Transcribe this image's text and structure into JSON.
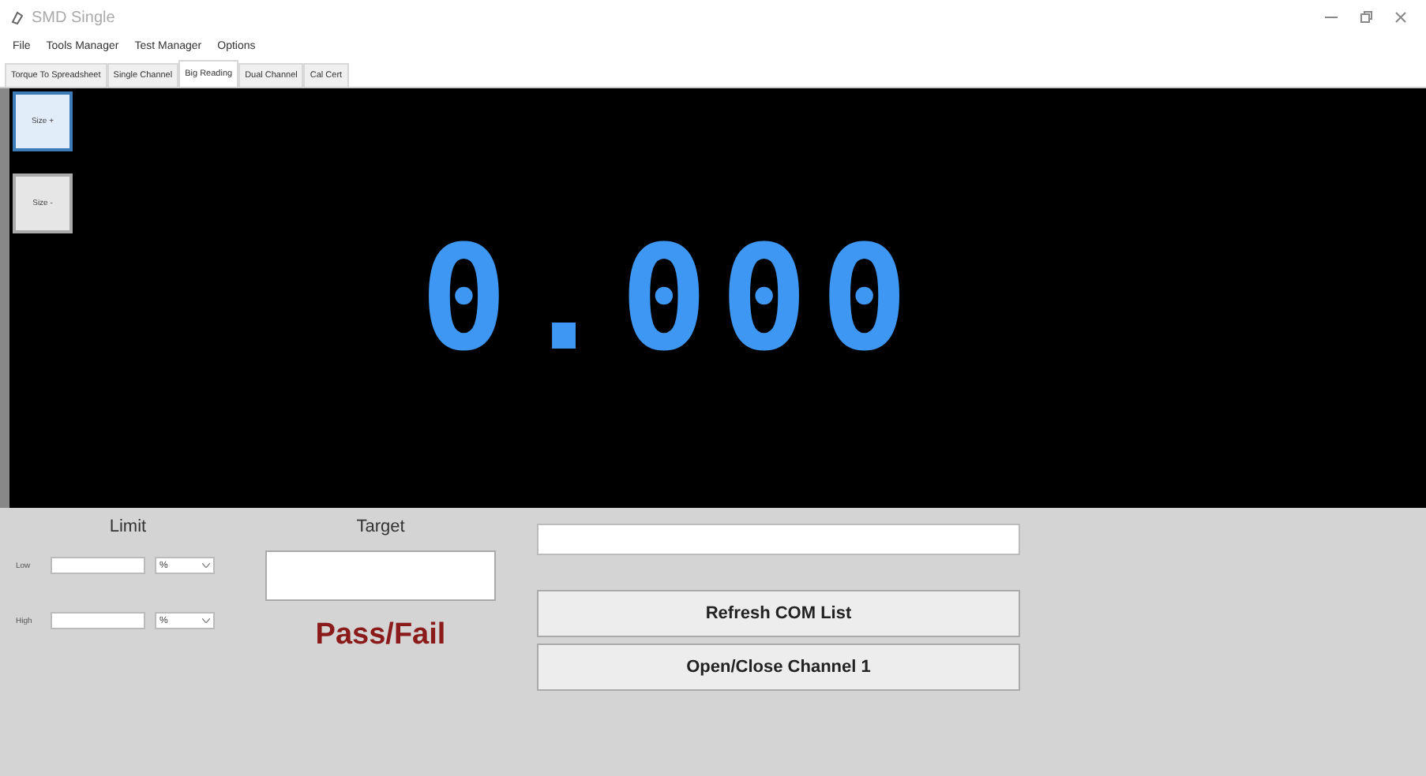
{
  "window": {
    "title": "SMD Single"
  },
  "menu": [
    "File",
    "Tools Manager",
    "Test Manager",
    "Options"
  ],
  "tabs": [
    {
      "label": "Torque To Spreadsheet",
      "selected": false
    },
    {
      "label": "Single Channel",
      "selected": false
    },
    {
      "label": "Big Reading",
      "selected": true
    },
    {
      "label": "Dual Channel",
      "selected": false
    },
    {
      "label": "Cal Cert",
      "selected": false
    }
  ],
  "size_buttons": [
    {
      "label": "Size +",
      "selected": true
    },
    {
      "label": "Size -",
      "selected": false
    }
  ],
  "reading": "0.000",
  "limit": {
    "title": "Limit",
    "rows": [
      {
        "label": "Low",
        "unit": "%"
      },
      {
        "label": "High",
        "unit": "%"
      }
    ]
  },
  "target": {
    "title": "Target",
    "result": "Pass/Fail"
  },
  "buttons": [
    "Refresh COM List",
    "Open/Close Channel 1"
  ]
}
